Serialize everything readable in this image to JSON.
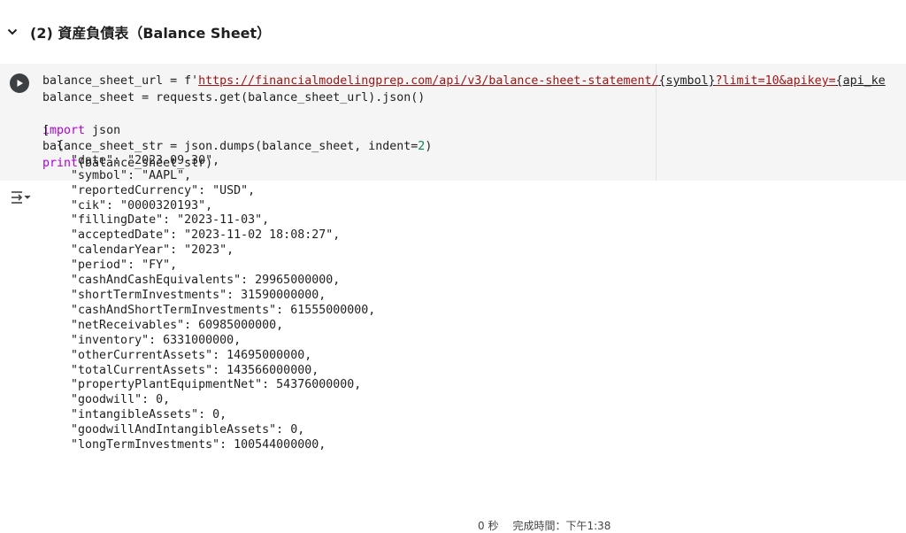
{
  "top_partial_text": "….…………………  …………………  … ………………",
  "section": {
    "title": "(2) 資産負債表（Balance Sheet）"
  },
  "code": {
    "line1_a": "balance_sheet_url = f'",
    "line1_url": "https://financialmodelingprep.com/api/v3/balance-sheet-statement/",
    "line1_b": "{symbol}",
    "line1_c": "?limit=10&apikey=",
    "line1_d": "{api_ke",
    "line2": "balance_sheet = requests.get(balance_sheet_url).json()",
    "line4_kw": "import",
    "line4_rest": " json",
    "line5_a": "balance_sheet_str = json.dumps(balance_sheet, indent=",
    "line5_num": "2",
    "line5_b": ")",
    "line6_fn": "print",
    "line6_rest": "(balance_sheet_str)"
  },
  "output_lines": [
    "[",
    "  {",
    "    \"date\": \"2023-09-30\",",
    "    \"symbol\": \"AAPL\",",
    "    \"reportedCurrency\": \"USD\",",
    "    \"cik\": \"0000320193\",",
    "    \"fillingDate\": \"2023-11-03\",",
    "    \"acceptedDate\": \"2023-11-02 18:08:27\",",
    "    \"calendarYear\": \"2023\",",
    "    \"period\": \"FY\",",
    "    \"cashAndCashEquivalents\": 29965000000,",
    "    \"shortTermInvestments\": 31590000000,",
    "    \"cashAndShortTermInvestments\": 61555000000,",
    "    \"netReceivables\": 60985000000,",
    "    \"inventory\": 6331000000,",
    "    \"otherCurrentAssets\": 14695000000,",
    "    \"totalCurrentAssets\": 143566000000,",
    "    \"propertyPlantEquipmentNet\": 54376000000,",
    "    \"goodwill\": 0,",
    "    \"intangibleAssets\": 0,",
    "    \"goodwillAndIntangibleAssets\": 0,",
    "    \"longTermInvestments\": 100544000000,"
  ],
  "status": {
    "elapsed": "0 秒",
    "completed": "完成時間：下午1:38"
  },
  "icons": {
    "collapse": "chevron-down-icon",
    "run": "play-icon",
    "output": "output-toggle-icon"
  }
}
